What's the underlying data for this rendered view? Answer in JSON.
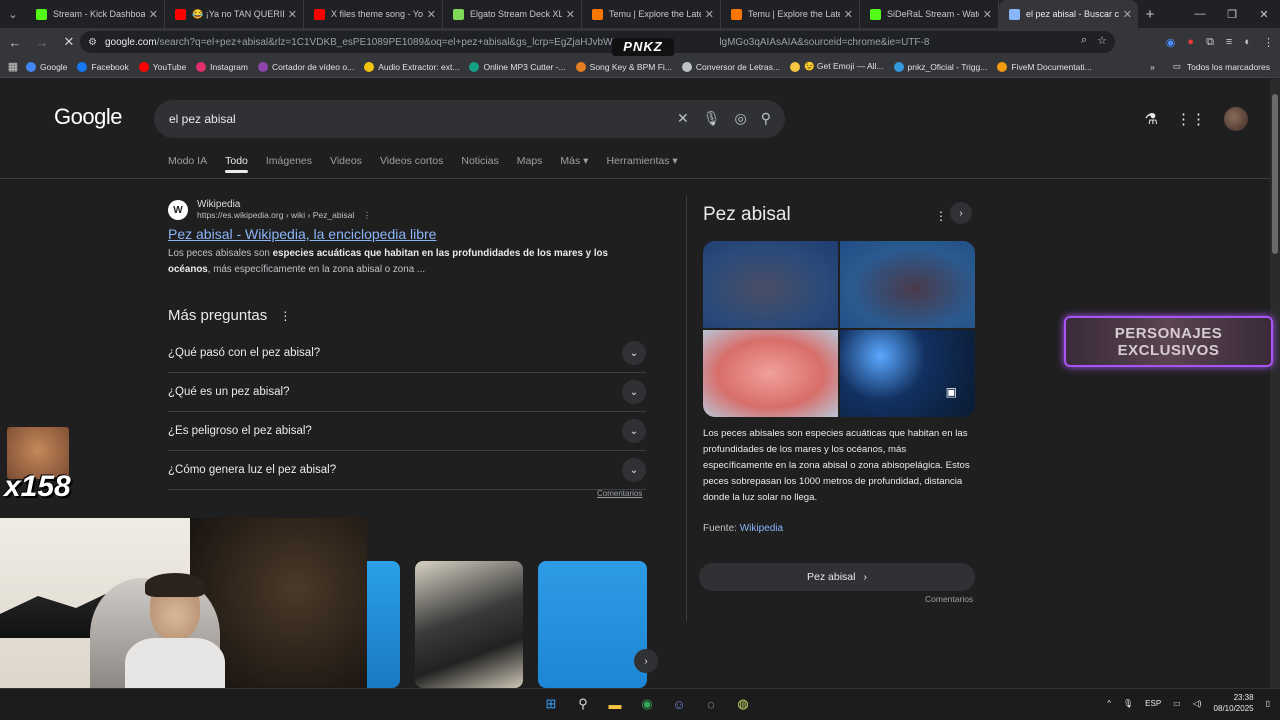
{
  "browser": {
    "tabs": [
      {
        "title": "Stream - Kick Dashboard",
        "color": "#53fc18",
        "active": false
      },
      {
        "title": "😂 ¡Ya no TAN QUERIDO",
        "color": "#ff0000",
        "active": false
      },
      {
        "title": "X files theme song - YouT",
        "color": "#ff0000",
        "active": false
      },
      {
        "title": "Elgato Stream Deck XL - C",
        "color": "#7ed957",
        "active": false
      },
      {
        "title": "Temu | Explore the Latest",
        "color": "#fb7701",
        "active": false
      },
      {
        "title": "Temu | Explore the Latest",
        "color": "#fb7701",
        "active": false
      },
      {
        "title": "SiDeRaL Stream - Watch L",
        "color": "#53fc18",
        "active": false
      },
      {
        "title": "el pez abisal - Buscar con",
        "color": "#8ab4f8",
        "active": true
      }
    ],
    "new_tab": "+",
    "url_main": "google.com",
    "url_rest": "/search?q=el+pez+abisal&rlz=1C1VDKB_esPE1089PE1089&oq=el+pez+abisal&gs_lcrp=EgZjaHJvbWUyBggAF",
    "url_tail": "lgMGo3qAIAsAIA&sourceid=chrome&ie=UTF-8",
    "bookmarks": [
      {
        "label": "Google",
        "color": "#4285f4"
      },
      {
        "label": "Facebook",
        "color": "#1877f2"
      },
      {
        "label": "YouTube",
        "color": "#ff0000"
      },
      {
        "label": "Instagram",
        "color": "#e1306c"
      },
      {
        "label": "Cortador de vídeo o...",
        "color": "#8e44ad"
      },
      {
        "label": "Audio Extractor: ext...",
        "color": "#f1c40f"
      },
      {
        "label": "Online MP3 Cutter -...",
        "color": "#16a085"
      },
      {
        "label": "Song Key & BPM Fi...",
        "color": "#e67e22"
      },
      {
        "label": "Conversor de Letras...",
        "color": "#bdc3c7"
      },
      {
        "label": "😉 Get Emoji — All...",
        "color": "#f5c542"
      },
      {
        "label": "pnkz_Oficial - Trigg...",
        "color": "#3498db"
      },
      {
        "label": "FiveM Documentati...",
        "color": "#f39c12"
      }
    ],
    "all_bookmarks": "Todos los marcadores"
  },
  "google": {
    "logo": "Google",
    "query": "el pez abisal",
    "nav": [
      "Modo IA",
      "Todo",
      "Imágenes",
      "Videos",
      "Videos cortos",
      "Noticias",
      "Maps",
      "Más ▾",
      "Herramientas ▾"
    ],
    "result": {
      "site": "Wikipedia",
      "url": "https://es.wikipedia.org › wiki › Pez_abisal",
      "title": "Pez abisal - Wikipedia, la enciclopedia libre",
      "snippet_pre": "Los peces abisales son ",
      "snippet_bold": "especies acuáticas que habitan en las profundidades de los mares y los océanos",
      "snippet_post": ", más específicamente en la zona abisal o zona ..."
    },
    "paa_title": "Más preguntas",
    "paa": [
      "¿Qué pasó con el pez abisal?",
      "¿Qué es un pez abisal?",
      "¿Es peligroso el pez abisal?",
      "¿Cómo genera luz el pez abisal?"
    ],
    "feedback": "Comentarios",
    "knowledge_panel": {
      "title": "Pez abisal",
      "description": "Los peces abisales son especies acuáticas que habitan en las profundidades de los mares y los océanos, más específicamente en la zona abisal o zona abisopelágica. Estos peces sobrepasan los 1000 metros de profundidad, distancia donde la luz solar no llega.",
      "source_label": "Fuente:",
      "source_link": "Wikipedia",
      "chip": "Pez abisal",
      "feedback": "Comentarios"
    }
  },
  "overlays": {
    "brand": "PNKZ",
    "badge_line1": "PERSONAJES",
    "badge_line2": "EXCLUSIVOS",
    "counter": "x158"
  },
  "taskbar": {
    "lang": "ESP",
    "time": "23:38",
    "date": "08/10/2025"
  }
}
